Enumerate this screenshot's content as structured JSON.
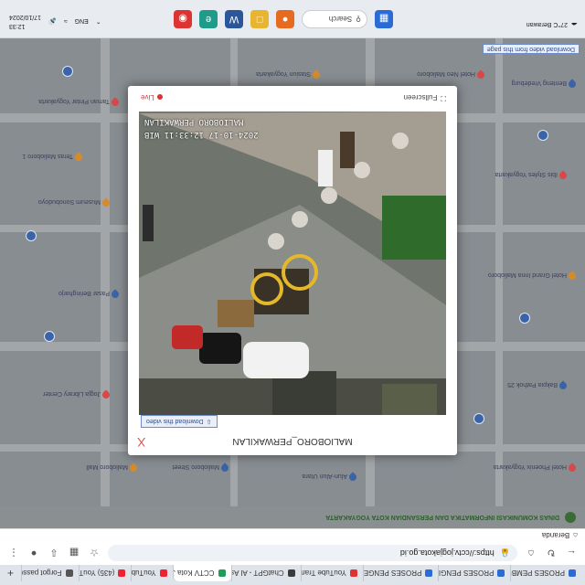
{
  "browser": {
    "tabs": [
      {
        "label": "PROSES PEMBUATAN",
        "color": "#2a6bd6"
      },
      {
        "label": "PROSES PENGIRIMAN",
        "color": "#2a6bd6"
      },
      {
        "label": "PROSES PENGEMASAN",
        "color": "#2a6bd6"
      },
      {
        "label": "YouTube Transcript",
        "color": "#d33"
      },
      {
        "label": "ChatGPT - AI Assistant",
        "color": "#3a3a3a"
      },
      {
        "label": "CCTV Kota Jogja",
        "color": "#1f9b5a",
        "active": true
      },
      {
        "label": "YouTube",
        "color": "#e23"
      },
      {
        "label": "(435) YouTube",
        "color": "#e23"
      },
      {
        "label": "Forgot password",
        "color": "#555"
      }
    ],
    "new_tab": "+",
    "url": "https://cctv.jogjakota.go.id",
    "bookmark_label": "Beranda"
  },
  "site": {
    "header_title": "DINAS KOMUNIKASI INFORMATIKA DAN PERSANDIAN KOTA YOGYAKARTA"
  },
  "map": {
    "labels": [
      "Hotel Phoenix Yogyakarta",
      "Malioboro Mall",
      "Bakpia Pathok 25",
      "Jogja Library Center",
      "Hotel Grand Inna Malioboro",
      "Pasar Beringharjo",
      "Ibis Styles Yogyakarta",
      "Museum Sonobudoyo",
      "Benteng Vredeburg",
      "Taman Pintar Yogyakarta",
      "Stasiun Yogyakarta",
      "Malioboro Street",
      "Hotel Neo Malioboro",
      "Teras Malioboro 1",
      "Alun-Alun Utara"
    ],
    "download_all": "Download video from this page"
  },
  "modal": {
    "title": "MALIOBORO_PERWAKILAN",
    "download_label": "Download this video",
    "close_label": "X",
    "timestamp": "2024-10-17 12:33:11 WIB",
    "camera_id": "MALIOBORO PERWAKILAN",
    "fullscreen_label": "Fullscreen",
    "live_label": "Live"
  },
  "taskbar": {
    "weather": "27°C Berawan",
    "search_label": "Search",
    "time": "12:33",
    "date": "17/10/2024",
    "lang": "ENG"
  }
}
